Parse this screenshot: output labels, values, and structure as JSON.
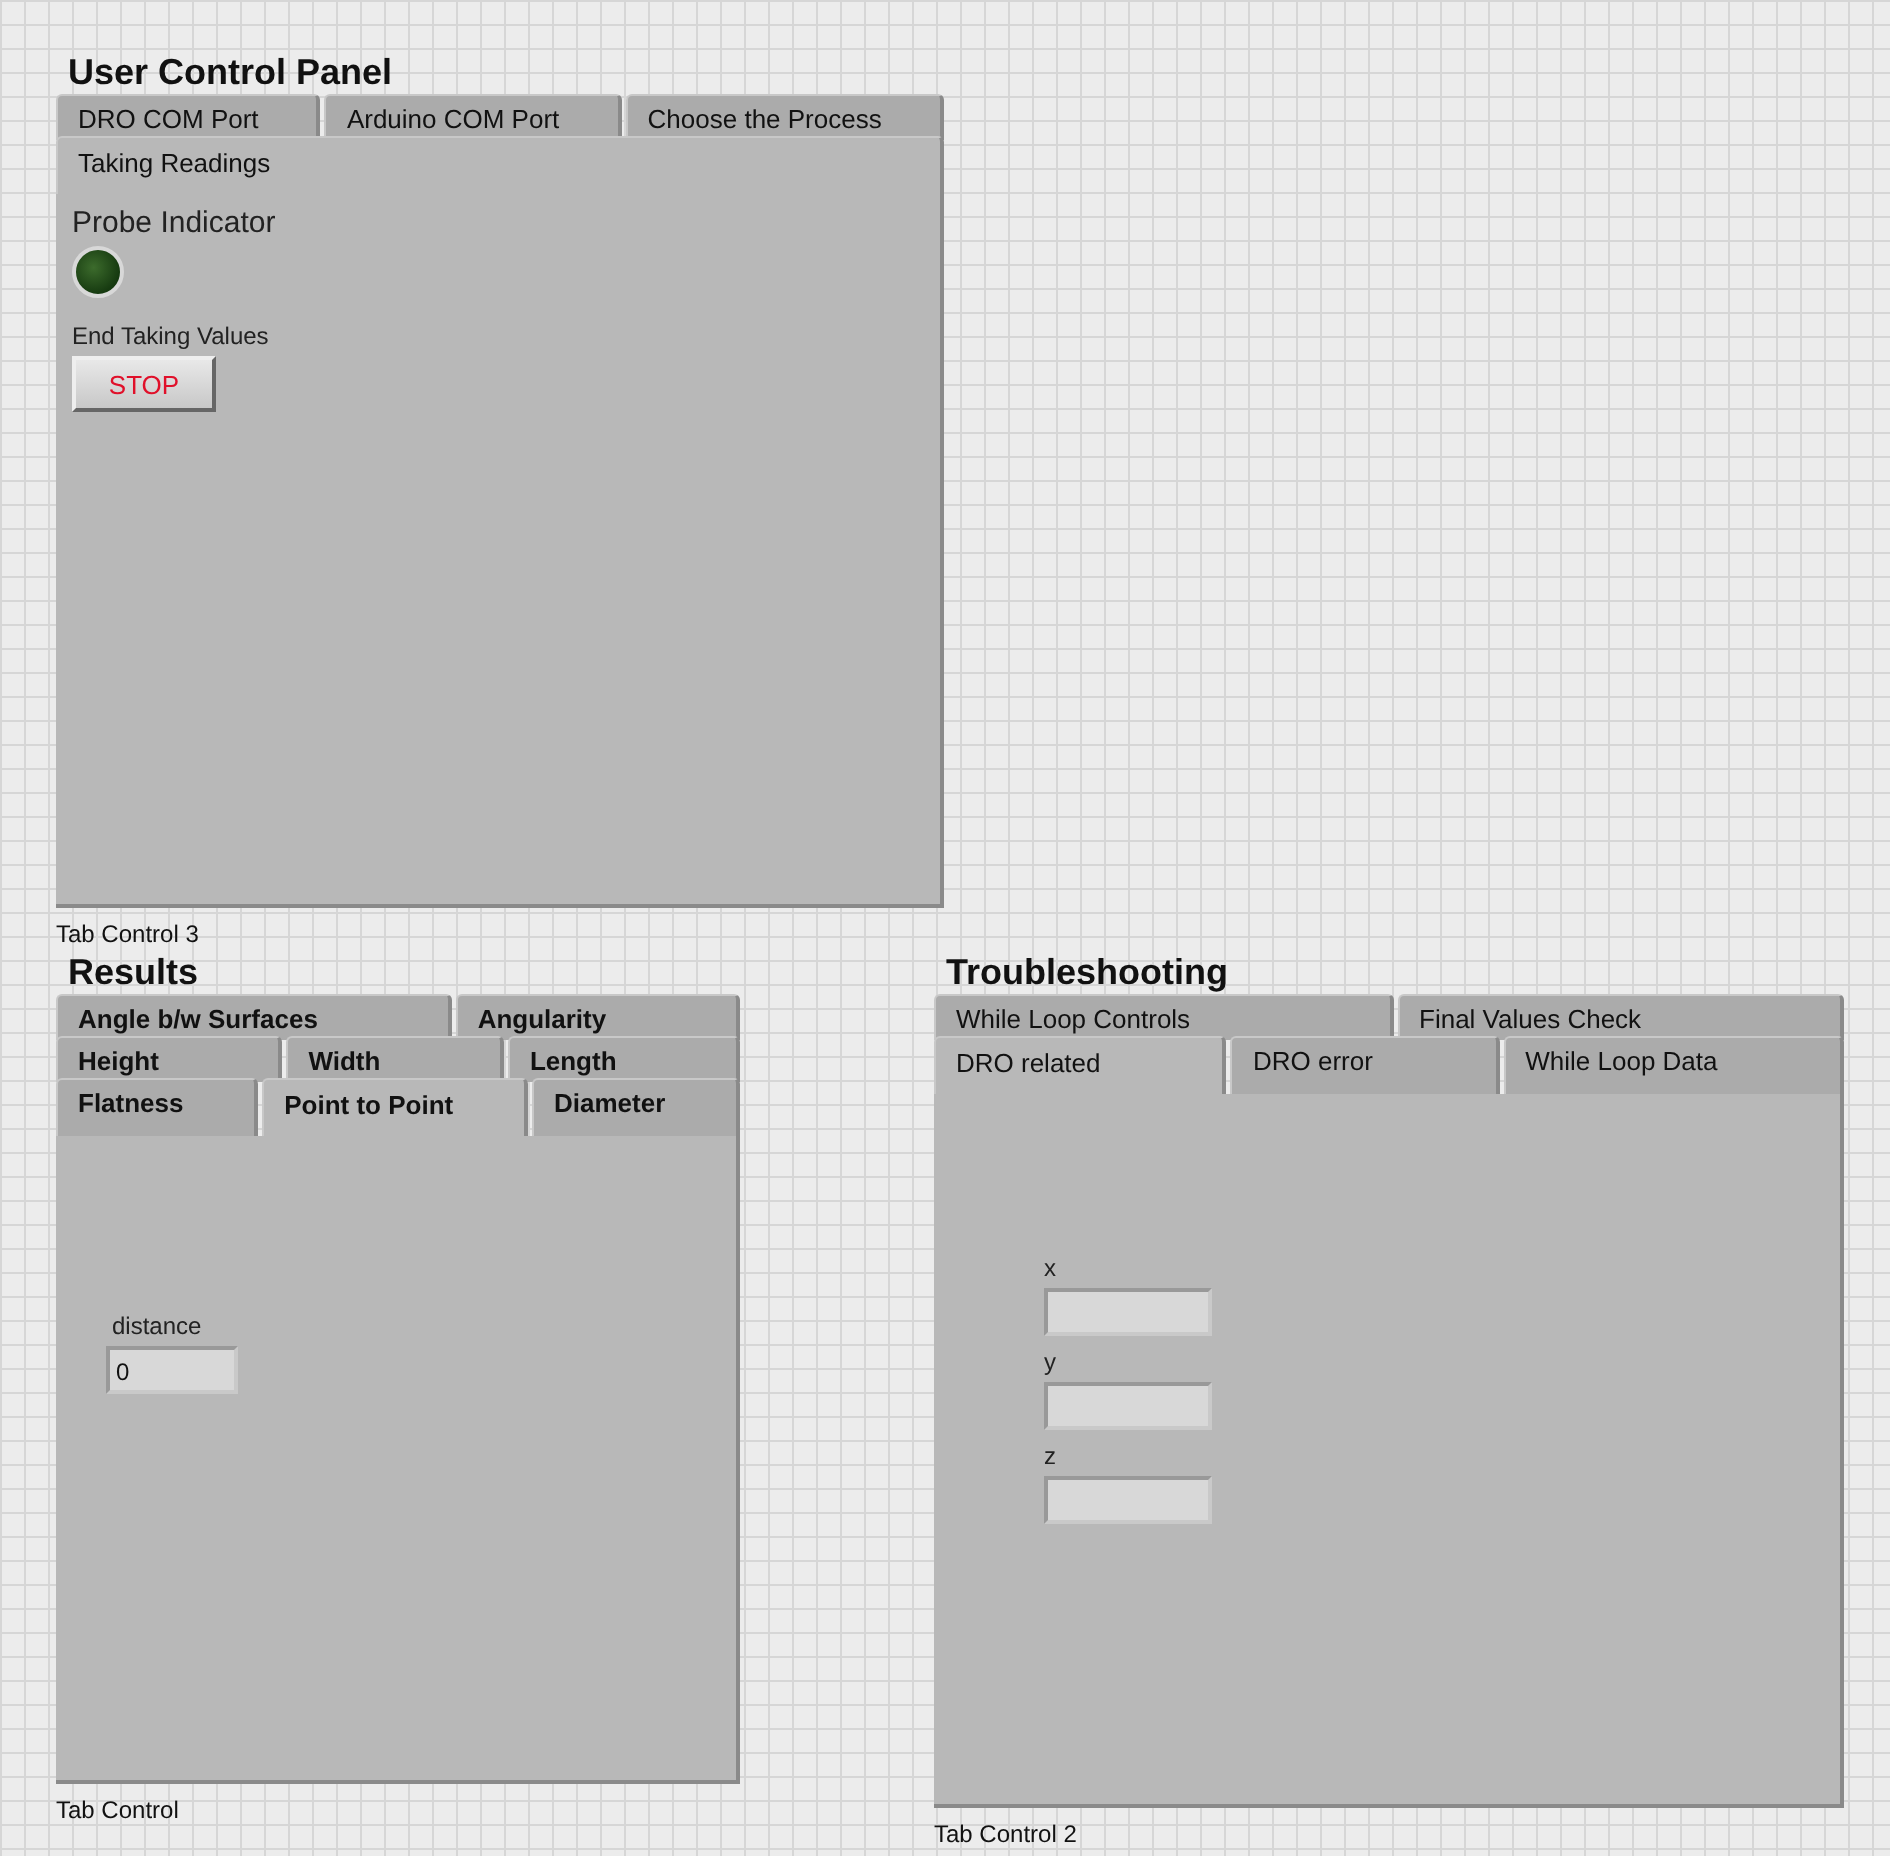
{
  "panels": [
    {
      "title": "User Control Panel",
      "caption": "Tab Control 3",
      "bold_tabs": false,
      "tab_rows": [
        [
          {
            "label": "DRO COM Port",
            "selected": false
          },
          {
            "label": "Arduino COM Port",
            "selected": false
          },
          {
            "label": "Choose the Process",
            "selected": false
          }
        ],
        [
          {
            "label": "Taking Readings",
            "selected": true
          }
        ]
      ],
      "items": [
        {
          "kind": "led",
          "label": "Probe Indicator",
          "on": false
        },
        {
          "kind": "button",
          "label": "End Taking Values",
          "text": "STOP"
        }
      ]
    },
    {
      "title": "Results",
      "caption": "Tab Control",
      "bold_tabs": true,
      "tab_rows": [
        [
          {
            "label": "Angle b/w Surfaces",
            "selected": false
          },
          {
            "label": "Angularity",
            "selected": false
          }
        ],
        [
          {
            "label": "Height",
            "selected": false
          },
          {
            "label": "Width",
            "selected": false
          },
          {
            "label": "Length",
            "selected": false
          }
        ],
        [
          {
            "label": "Flatness",
            "selected": false
          },
          {
            "label": "Point to Point",
            "selected": true
          },
          {
            "label": "Diameter",
            "selected": false
          }
        ]
      ],
      "items": [
        {
          "kind": "numeric",
          "label": "distance",
          "value": "0"
        }
      ]
    },
    {
      "title": "Troubleshooting",
      "caption": "Tab Control 2",
      "bold_tabs": false,
      "tab_rows": [
        [
          {
            "label": "While Loop Controls",
            "selected": false
          },
          {
            "label": "Final Values Check",
            "selected": false
          }
        ],
        [
          {
            "label": "DRO related",
            "selected": true
          },
          {
            "label": "DRO error",
            "selected": false
          },
          {
            "label": "While Loop Data",
            "selected": false
          }
        ]
      ],
      "items": [
        {
          "kind": "numeric",
          "label": "x"
        },
        {
          "kind": "numeric",
          "label": "y"
        },
        {
          "kind": "numeric",
          "label": "z"
        }
      ]
    }
  ]
}
